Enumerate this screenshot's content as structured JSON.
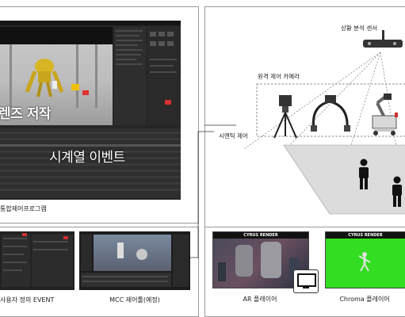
{
  "main_program": {
    "overlay_top": "렌즈 저작",
    "overlay_bottom": "시계열 이벤트",
    "caption": "통합제어프로그램"
  },
  "sub_panels": [
    {
      "caption": "사용자 정의 EVENT"
    },
    {
      "caption": "MCC 제어툴(예정)"
    }
  ],
  "diagram": {
    "sensor_label": "상황 분석 센서",
    "camera_label": "원격 제어 카메라",
    "semantic_label": "시멘틱 제어"
  },
  "players": [
    {
      "header": "CYRUS RENDER",
      "caption": "AR 플레이어"
    },
    {
      "header": "CYRUS RENDER",
      "caption": "Chroma 플레이어"
    }
  ],
  "colors": {
    "chroma_green": "#33dd22",
    "dark_ui": "#1e1e1e",
    "accent_red": "#d03030"
  }
}
